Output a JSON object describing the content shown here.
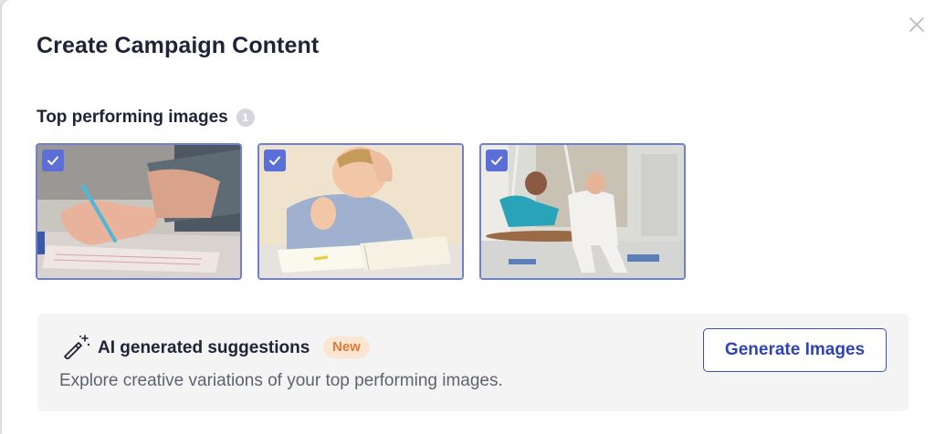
{
  "modal": {
    "title": "Create Campaign Content",
    "close_icon": "close-icon"
  },
  "top_images": {
    "label": "Top performing images",
    "count": "1",
    "items": [
      {
        "description": "child writing with pencil",
        "selected": true
      },
      {
        "description": "frustrated boy with book",
        "selected": true
      },
      {
        "description": "therapist with girl on swing",
        "selected": true
      }
    ],
    "check_icon": "checkmark-icon",
    "accent_color": "#5b6fd6"
  },
  "ai_suggestions": {
    "icon": "magic-wand-icon",
    "title": "AI generated suggestions",
    "badge": "New",
    "description": "Explore creative variations of your top performing images.",
    "button_label": "Generate Images",
    "badge_color": "#e07a2e"
  }
}
